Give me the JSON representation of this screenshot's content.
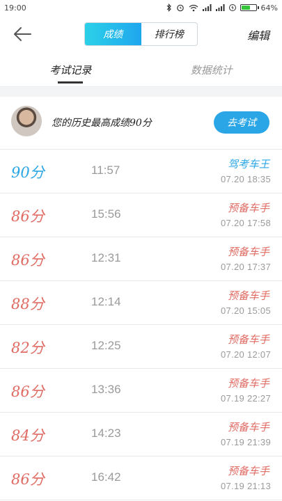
{
  "status_bar": {
    "time": "19:00",
    "battery_percent": "64%",
    "battery_level": 0.64,
    "icons": [
      "bluetooth-icon",
      "alarm-icon",
      "wifi-icon",
      "signal-icon",
      "signal-icon",
      "charging-icon",
      "battery-icon"
    ]
  },
  "header": {
    "back_icon": "arrow-left-icon",
    "tabs": [
      {
        "label": "成绩",
        "active": true
      },
      {
        "label": "排行榜",
        "active": false
      }
    ],
    "edit_label": "编辑"
  },
  "subtabs": [
    {
      "label": "考试记录",
      "active": true
    },
    {
      "label": "数据统计",
      "active": false
    }
  ],
  "best": {
    "avatar": "user-avatar",
    "text": "您的历史最高成绩90分",
    "button_label": "去考试"
  },
  "colors": {
    "accent": "#2aa6e6",
    "top_score": "#2aa6e6",
    "normal_score": "#e06b63"
  },
  "records": [
    {
      "score": "90分",
      "duration": "11:57",
      "title": "驾考车王",
      "datetime": "07.20  18:35",
      "top": true
    },
    {
      "score": "86分",
      "duration": "15:56",
      "title": "预备车手",
      "datetime": "07.20  17:58",
      "top": false
    },
    {
      "score": "86分",
      "duration": "12:31",
      "title": "预备车手",
      "datetime": "07.20  17:37",
      "top": false
    },
    {
      "score": "88分",
      "duration": "12:14",
      "title": "预备车手",
      "datetime": "07.20  15:05",
      "top": false
    },
    {
      "score": "82分",
      "duration": "12:25",
      "title": "预备车手",
      "datetime": "07.20  12:07",
      "top": false
    },
    {
      "score": "86分",
      "duration": "13:36",
      "title": "预备车手",
      "datetime": "07.19  22:27",
      "top": false
    },
    {
      "score": "84分",
      "duration": "14:23",
      "title": "预备车手",
      "datetime": "07.19  21:39",
      "top": false
    },
    {
      "score": "86分",
      "duration": "16:42",
      "title": "预备车手",
      "datetime": "07.19  21:13",
      "top": false
    }
  ]
}
